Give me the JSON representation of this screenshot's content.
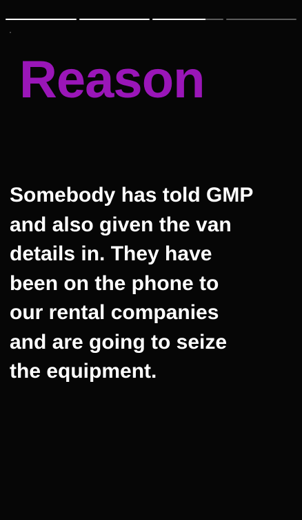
{
  "story": {
    "heading": "Reason",
    "heading_color": "#9a16b8",
    "body_lines": [
      "Somebody has told GMP",
      "and also given the van",
      "details in. They have",
      "been on the phone to",
      "our rental companies",
      "and are going to seize",
      "the equipment."
    ]
  },
  "progress": {
    "segments": [
      {
        "fill": 1.0
      },
      {
        "fill": 1.0
      },
      {
        "fill": 0.75
      },
      {
        "fill": 0.0
      }
    ]
  }
}
